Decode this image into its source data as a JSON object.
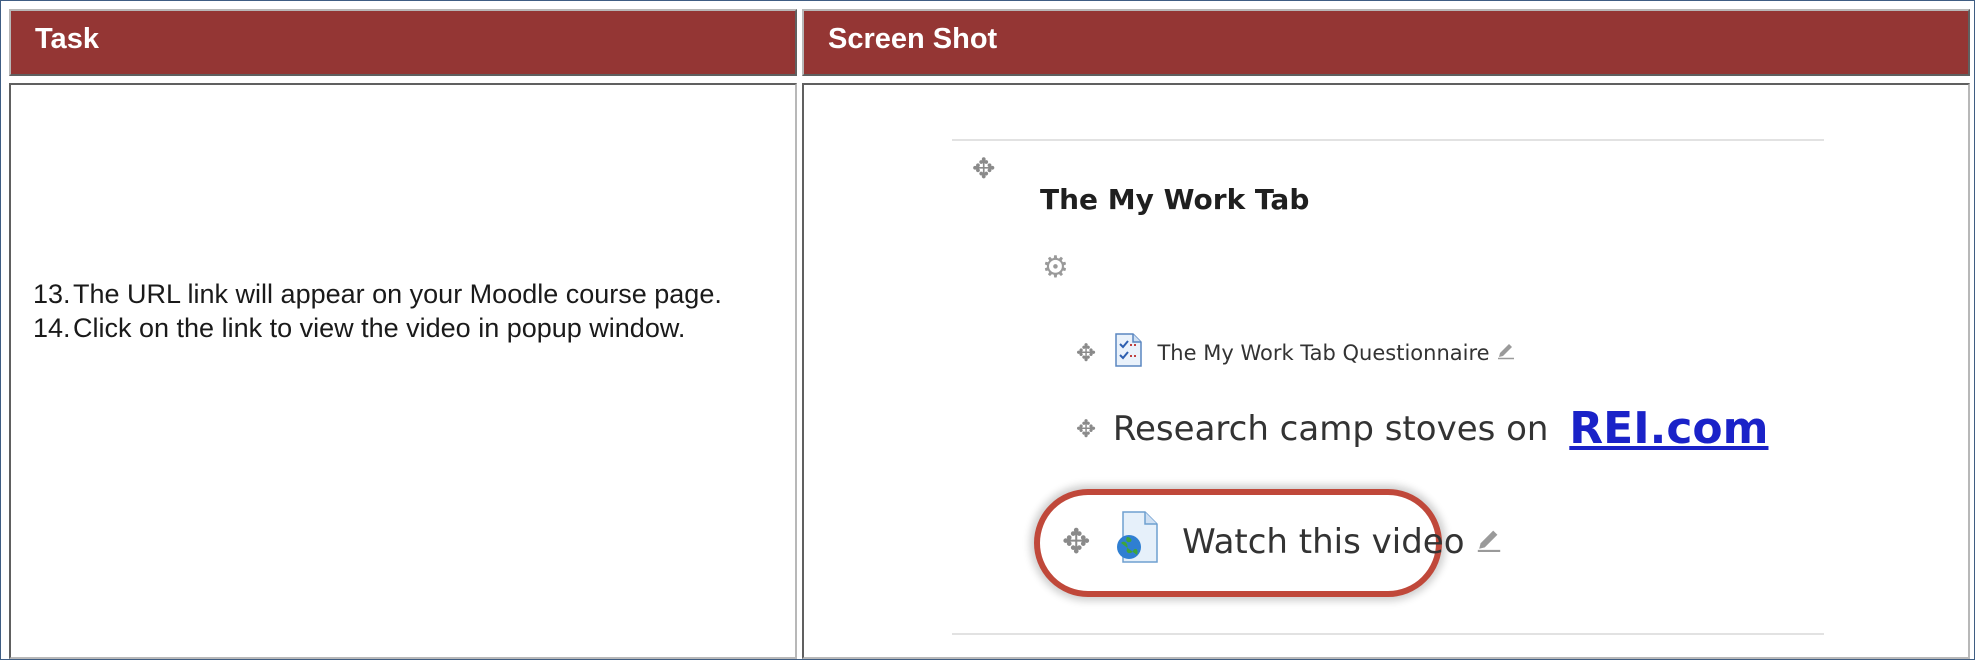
{
  "header": {
    "task_label": "Task",
    "screenshot_label": "Screen Shot"
  },
  "task": {
    "steps": [
      {
        "number": "13.",
        "text": "The URL link will appear on your Moodle course page."
      },
      {
        "number": "14.",
        "text": "Click on the link to view the video in popup window."
      }
    ]
  },
  "screenshot": {
    "section_title": "The My Work Tab",
    "items": [
      {
        "label": "The My Work Tab Questionnaire",
        "icon": "questionnaire-icon"
      },
      {
        "prefix": "Research camp stoves on",
        "link": "REI.com"
      },
      {
        "label": "Watch this video",
        "icon": "url-globe-icon",
        "highlighted": true
      }
    ],
    "colors": {
      "header_bg": "#943634",
      "link": "#1a22c8",
      "highlight_ring": "#c0483a"
    }
  }
}
